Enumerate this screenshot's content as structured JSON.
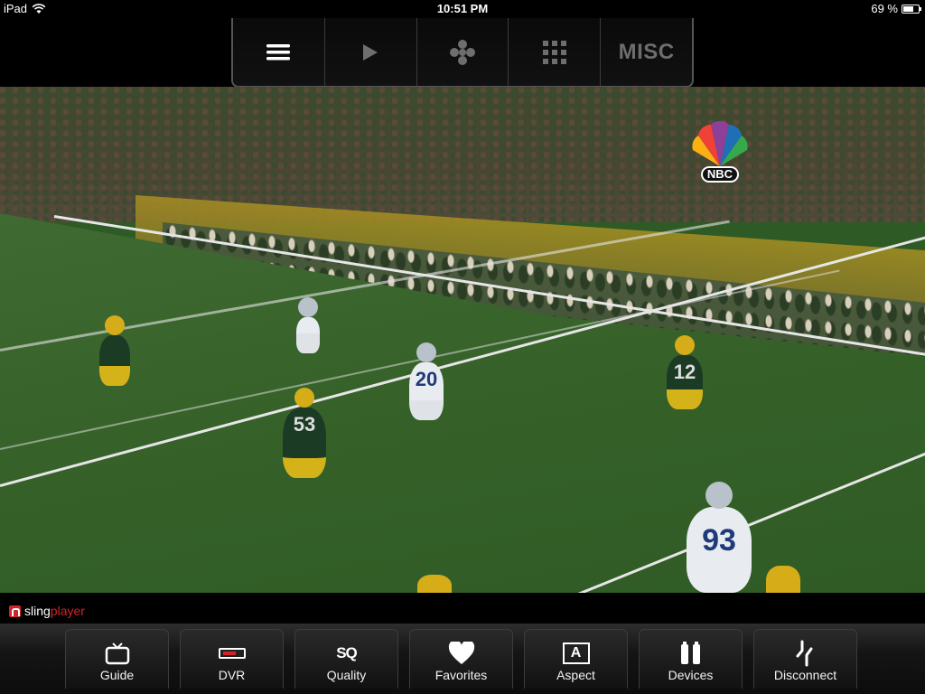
{
  "status_bar": {
    "device": "iPad",
    "time": "10:51 PM",
    "battery": "69 %",
    "battery_level": 0.69,
    "icons": [
      "wifi-icon",
      "battery-icon"
    ]
  },
  "top_controls": {
    "items": [
      {
        "name": "menu",
        "icon": "menu-lines-icon"
      },
      {
        "name": "play",
        "icon": "play-icon"
      },
      {
        "name": "dpad",
        "icon": "dpad-icon"
      },
      {
        "name": "keypad",
        "icon": "keypad-grid-icon"
      },
      {
        "name": "misc",
        "label": "MISC"
      }
    ]
  },
  "video": {
    "network_logo_text": "NBC",
    "jerseys": [
      "12",
      "53",
      "20",
      "93"
    ]
  },
  "brand": {
    "part1": "sling",
    "part2": "player"
  },
  "toolbar": {
    "buttons": [
      {
        "label": "Guide",
        "icon": "tv-icon"
      },
      {
        "label": "DVR",
        "icon": "dvr-icon"
      },
      {
        "label": "Quality",
        "icon": "sq-icon",
        "icon_text": "SQ"
      },
      {
        "label": "Favorites",
        "icon": "heart-icon"
      },
      {
        "label": "Aspect",
        "icon": "aspect-icon",
        "icon_text": "A"
      },
      {
        "label": "Devices",
        "icon": "devices-icon"
      },
      {
        "label": "Disconnect",
        "icon": "disconnect-icon"
      }
    ]
  },
  "colors": {
    "brand_red": "#d2232a",
    "toolbar_bg": "#151515",
    "field_green": "#356129"
  }
}
